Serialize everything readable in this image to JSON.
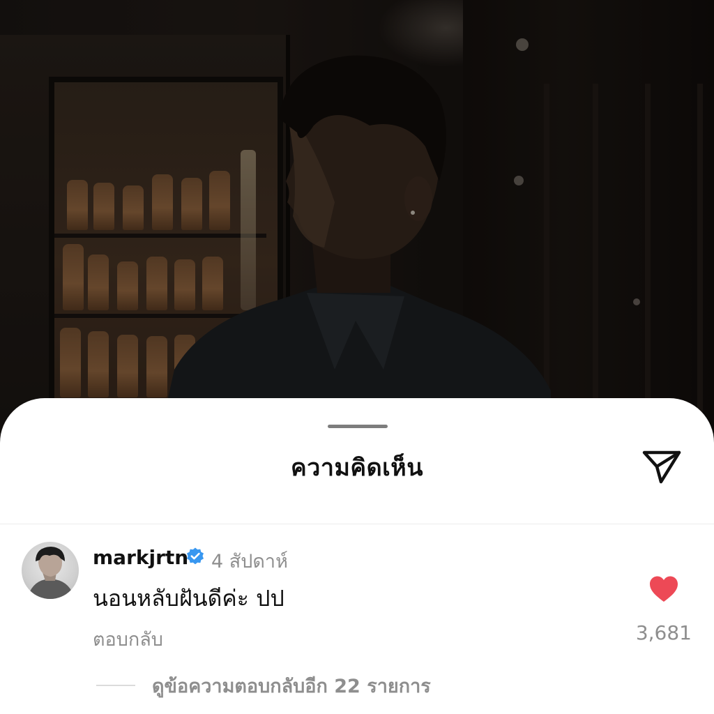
{
  "sheet": {
    "title": "ความคิดเห็น"
  },
  "icons": {
    "share": "paper-plane-icon",
    "verified": "verified-badge-icon",
    "like": "heart-icon",
    "verified_color": "#3897f0",
    "like_color": "#ed4956"
  },
  "comment": {
    "username": "markjrtn",
    "timestamp": "4 สัปดาห์",
    "text": "นอนหลับฝันดีค่ะ ปป",
    "reply_label": "ตอบกลับ",
    "like_count": "3,681",
    "liked": true
  },
  "replies": {
    "view_more_label": "ดูข้อความตอบกลับอีก 22 รายการ"
  }
}
